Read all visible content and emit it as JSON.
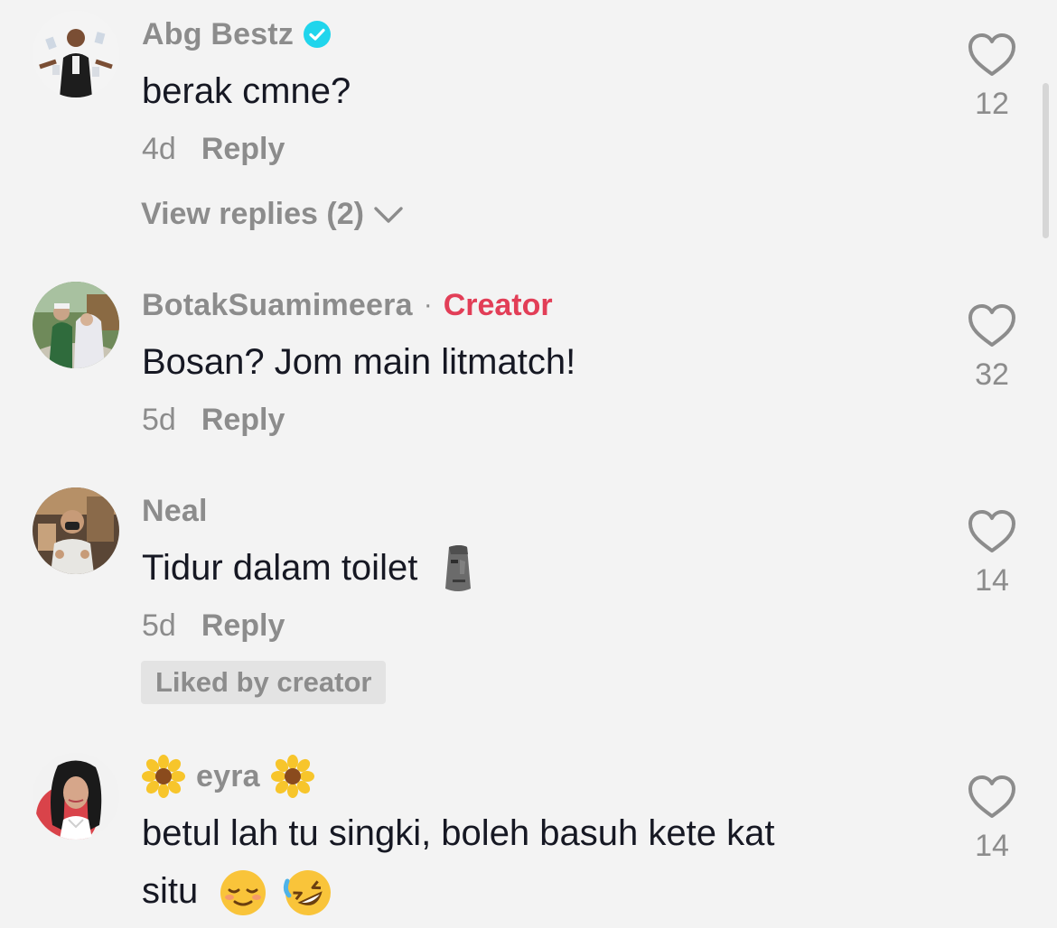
{
  "comments": [
    {
      "username": "Abg Bestz",
      "verified": true,
      "text": "berak cmne?",
      "time": "4d",
      "reply": "Reply",
      "view_replies": "View replies (2)",
      "likes": "12"
    },
    {
      "username": "BotakSuamimeera",
      "separator": "·",
      "creator_label": "Creator",
      "text": "Bosan? Jom main litmatch!",
      "time": "5d",
      "reply": "Reply",
      "likes": "32"
    },
    {
      "username": "Neal",
      "text": "Tidur dalam toilet",
      "text_emoji": "moai-emoji",
      "time": "5d",
      "reply": "Reply",
      "liked_by_creator": "Liked by creator",
      "likes": "14"
    },
    {
      "username": "eyra",
      "username_decoration": "sunflower-emoji",
      "text_line1": "betul lah tu singki, boleh basuh kete kat",
      "text_line2": "situ",
      "text_emojis": [
        "relieved-face-emoji",
        "rolling-laughing-emoji"
      ],
      "likes": "14"
    }
  ],
  "colors": {
    "background": "#f3f3f3",
    "secondary_text": "#8c8c8c",
    "primary_text": "#161823",
    "creator_red": "#e23e57",
    "verified_blue": "#20d5ec"
  }
}
